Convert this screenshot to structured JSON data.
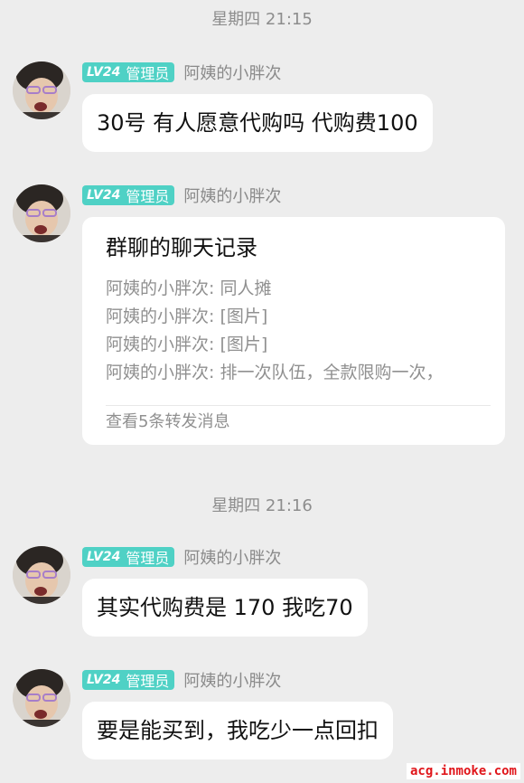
{
  "timestamps": [
    "星期四 21:15",
    "星期四 21:16"
  ],
  "badge": {
    "level": "LV24",
    "role": "管理员",
    "color": "#4fd1c5"
  },
  "sender_name": "阿姨的小胖次",
  "messages": [
    {
      "type": "text",
      "text": "30号 有人愿意代购吗 代购费100"
    },
    {
      "type": "forward_card",
      "title": "群聊的聊天记录",
      "lines": [
        "阿姨的小胖次: 同人摊",
        "阿姨的小胖次: [图片]",
        "阿姨的小胖次: [图片]",
        "阿姨的小胖次: 排一次队伍，全款限购一次，"
      ],
      "footer": "查看5条转发消息"
    },
    {
      "type": "text",
      "text": "其实代购费是 170  我吃70"
    },
    {
      "type": "text",
      "text": "要是能买到，我吃少一点回扣"
    }
  ],
  "watermark": "acg.inmoke.com"
}
